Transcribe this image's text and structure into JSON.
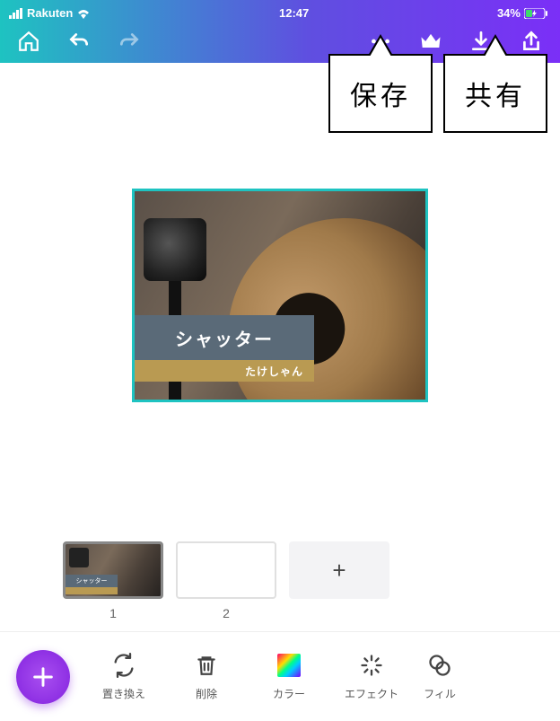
{
  "status": {
    "carrier": "Rakuten",
    "time": "12:47",
    "battery": "34%"
  },
  "callouts": {
    "save": "保存",
    "share": "共有"
  },
  "canvas": {
    "title": "シャッター",
    "subtitle": "たけしゃん"
  },
  "thumbs": {
    "page1": "1",
    "page2": "2"
  },
  "tools": {
    "replace": "置き換え",
    "delete": "削除",
    "color": "カラー",
    "effect": "エフェクト",
    "filter": "フィル"
  }
}
